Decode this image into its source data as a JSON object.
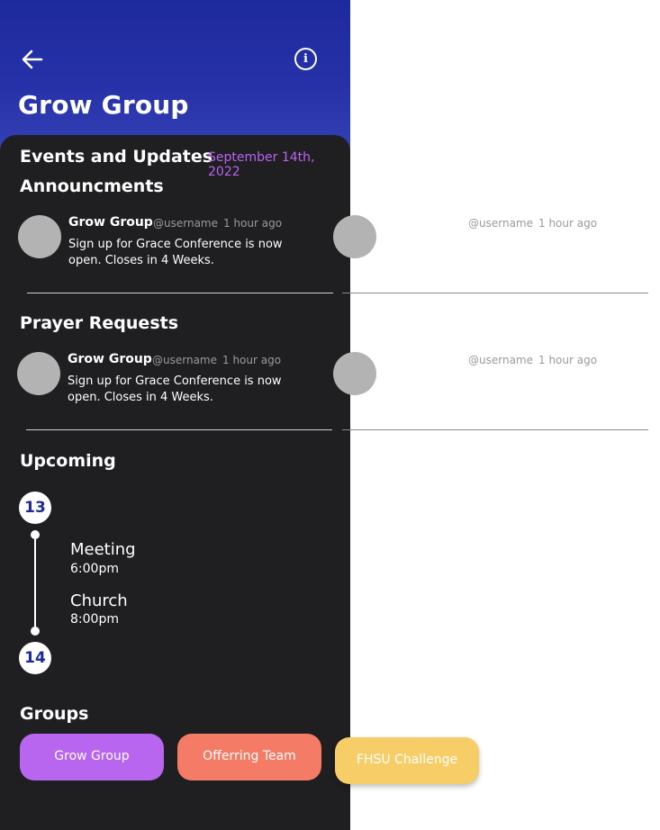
{
  "header": {
    "title": "Grow Group",
    "back_icon": "arrow-left-icon",
    "info_icon": "info-icon",
    "info_glyph": "i"
  },
  "events": {
    "heading": "Events and Updates",
    "date": "September 14th, 2022"
  },
  "announcements": {
    "heading": "Announcments",
    "post": {
      "author": "Grow Group",
      "username": "@username",
      "time": "1 hour ago",
      "text": "Sign up for Grace Conference is now open. Closes in 4 Weeks."
    },
    "ghost_post": {
      "username": "@username",
      "time": "1 hour ago"
    }
  },
  "prayer": {
    "heading": "Prayer Requests",
    "post": {
      "author": "Grow Group",
      "username": "@username",
      "time": "1 hour ago",
      "text": "Sign up for Grace Conference is now open. Closes in 4 Weeks."
    },
    "ghost_post": {
      "username": "@username",
      "time": "1 hour ago"
    }
  },
  "upcoming": {
    "heading": "Upcoming",
    "start_day": "13",
    "end_day": "14",
    "events": [
      {
        "title": "Meeting",
        "time": "6:00pm"
      },
      {
        "title": "Church",
        "time": "8:00pm"
      }
    ]
  },
  "groups": {
    "heading": "Groups",
    "chips": [
      {
        "label": "Grow Group",
        "color": "#b865ef"
      },
      {
        "label": "Offerring Team",
        "color": "#f47c66"
      },
      {
        "label": "FHSU Challenge",
        "color": "#f7cd67"
      }
    ]
  },
  "colors": {
    "header_gradient_top": "#1d2a9c",
    "panel_bg": "#1f1f21",
    "date_accent": "#b964f0",
    "avatar": "#b3b3b3"
  }
}
